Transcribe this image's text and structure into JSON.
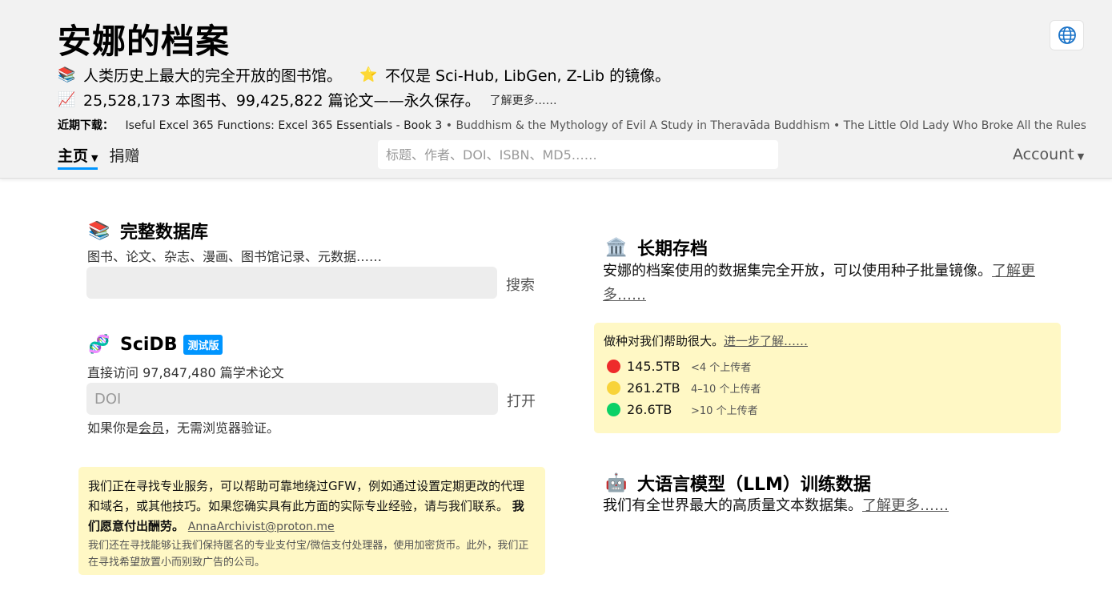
{
  "header": {
    "title": "安娜的档案",
    "tagline1": {
      "icon": "📚",
      "text": "人类历史上最大的完全开放的图书馆。",
      "star_icon": "⭐",
      "text2": "不仅是 Sci-Hub, LibGen, Z-Lib 的镜像。"
    },
    "tagline2": {
      "icon": "📈",
      "text": "25,528,173 本图书、99,425,822 篇论文——永久保存。",
      "learn_more": "了解更多……"
    },
    "recent": {
      "label": "近期下载：",
      "first": "Iseful Excel 365 Functions: Excel 365 Essentials - Book 3",
      "rest": " • Buddhism & the Mythology of Evil A Study in Theravāda Buddhism • The Little Old Lady Who Broke All the Rules • The Six Wi"
    },
    "nav": {
      "home": "主页",
      "donate": "捐赠",
      "caret": "▼"
    },
    "search_placeholder": "标题、作者、DOI、ISBN、MD5……",
    "account": "Account"
  },
  "left": {
    "db": {
      "icon": "📚",
      "title": "完整数据库",
      "subtitle": "图书、论文、杂志、漫画、图书馆记录、元数据……",
      "button": "搜索",
      "placeholder": ""
    },
    "scidb": {
      "icon": "🧬",
      "title": "SciDB",
      "badge": "测试版",
      "subtitle": "直接访问 97,847,480 篇学术论文",
      "placeholder": "DOI",
      "button": "打开"
    },
    "member_note": {
      "prefix": "如果你是",
      "link": "会员",
      "suffix": "，无需浏览器验证。"
    },
    "notice": {
      "main": "我们正在寻找专业服务，可以帮助可靠地绕过GFW，例如通过设置定期更改的代理和域名，或其他技巧。如果您确实具有此方面的实际专业经验，请与我们联系。",
      "bold": "我们愿意付出酬劳。",
      "email": "AnnaArchivist@proton.me",
      "sub": "我们还在寻找能够让我们保持匿名的专业支付宝/微信支付处理器，使用加密货币。此外，我们正在寻找希望放置小而别致广告的公司。"
    }
  },
  "right": {
    "archive": {
      "icon": "🏛️",
      "title": "长期存档",
      "text": "安娜的档案使用的数据集完全开放，可以使用种子批量镜像。",
      "link": "了解更多……"
    },
    "seeds": {
      "head": "做种对我们帮助很大。",
      "head_link": "进一步了解……",
      "rows": [
        {
          "size": "145.5TB",
          "count": "<4 个上传者",
          "color": "#ee2b2b"
        },
        {
          "size": "261.2TB",
          "count": "4–10 个上传者",
          "color": "#f8d33a"
        },
        {
          "size": "26.6TB",
          "count": ">10 个上传者",
          "color": "#0bd166"
        }
      ]
    },
    "llm": {
      "icon": "🤖",
      "title": "大语言模型（LLM）训练数据",
      "text": "我们有全世界最大的高质量文本数据集。",
      "link": "了解更多……"
    }
  }
}
